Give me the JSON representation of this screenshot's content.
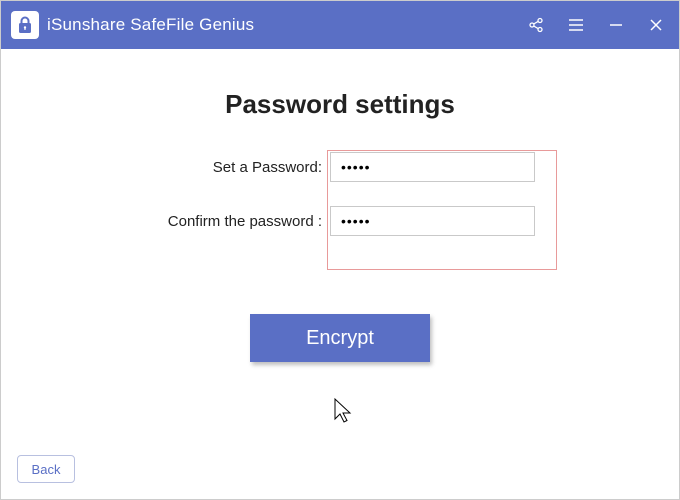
{
  "titlebar": {
    "app_name": "iSunshare SafeFile Genius"
  },
  "page": {
    "heading": "Password settings"
  },
  "form": {
    "set_password_label": "Set a Password:",
    "set_password_value": "•••••",
    "confirm_password_label": "Confirm the password  :",
    "confirm_password_value": "•••••"
  },
  "buttons": {
    "encrypt": "Encrypt",
    "back": "Back"
  },
  "colors": {
    "accent": "#5a6fc5",
    "highlight_border": "#e89a9a"
  }
}
